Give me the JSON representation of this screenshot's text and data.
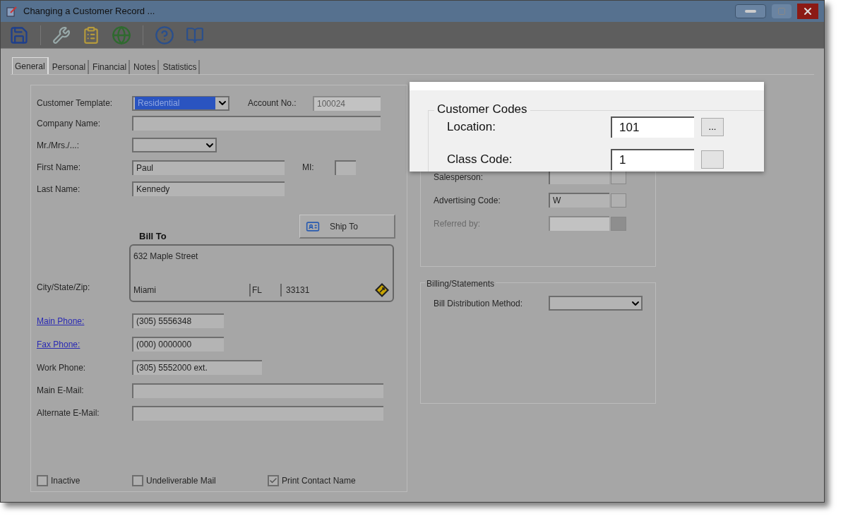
{
  "window": {
    "title": "Changing a Customer Record ..."
  },
  "tabs": [
    {
      "label": "General",
      "selected": true
    },
    {
      "label": "Personal",
      "selected": false
    },
    {
      "label": "Financial",
      "selected": false
    },
    {
      "label": "Notes",
      "selected": false
    },
    {
      "label": "Statistics",
      "selected": false
    }
  ],
  "customer_form": {
    "customer_template": {
      "label": "Customer Template:",
      "value": "Residential"
    },
    "account_no": {
      "label": "Account No.:",
      "value": "100024",
      "disabled": true
    },
    "company_name": {
      "label": "Company Name:"
    },
    "salutation": {
      "label": "Mr./Mrs./...:"
    },
    "first_name": {
      "label": "First Name:",
      "value": "Paul"
    },
    "mi": {
      "label": "MI:"
    },
    "last_name": {
      "label": "Last Name:",
      "value": "Kennedy"
    },
    "ship_to_button": "Ship To",
    "bill_to": {
      "heading": "Bill To",
      "street": "632 Maple Street",
      "city_label": "City/State/Zip:",
      "city": "Miami",
      "state": "FL",
      "zip": "33131"
    },
    "phones": [
      {
        "label": "Main Phone:",
        "value": "(305) 5556348",
        "kind": "link"
      },
      {
        "label": "Fax Phone:",
        "value": "(000) 0000000",
        "kind": "link"
      },
      {
        "label": "Work Phone:",
        "value": "(305) 5552000 ext.",
        "kind": "plain"
      }
    ],
    "emails": [
      {
        "label": "Main E-Mail:"
      },
      {
        "label": "Alternate E-Mail:"
      }
    ],
    "checkboxes": [
      {
        "label": "Inactive",
        "checked": false
      },
      {
        "label": "Undeliverable Mail",
        "checked": false
      },
      {
        "label": "Print Contact Name",
        "checked": true
      }
    ]
  },
  "codes_group": {
    "rows": [
      {
        "label": "Salesperson:",
        "disabled": false
      },
      {
        "label": "Advertising Code:",
        "value": "W",
        "disabled": false
      },
      {
        "label": "Referred by:",
        "disabled": true
      }
    ]
  },
  "billing": {
    "title": "Billing/Statements",
    "label": "Bill Distribution Method:"
  },
  "customer_codes_popup": {
    "title": "Customer Codes",
    "rows": [
      {
        "label": "Location:",
        "value": "101",
        "button": "..."
      },
      {
        "label": "Class Code:",
        "value": "1"
      }
    ]
  }
}
